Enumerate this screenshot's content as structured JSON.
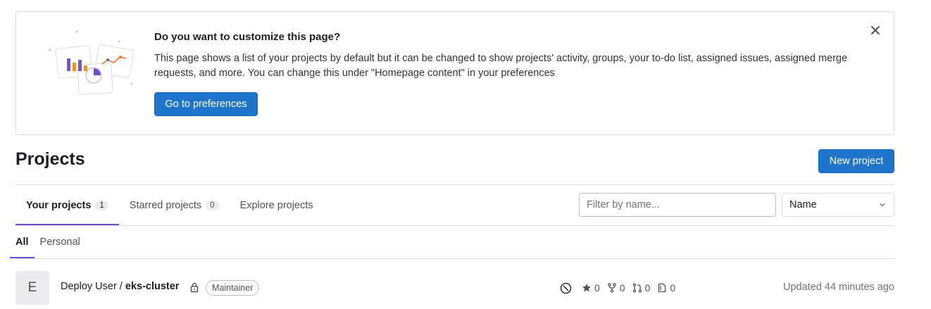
{
  "banner": {
    "title": "Do you want to customize this page?",
    "body": "This page shows a list of your projects by default but it can be changed to show projects' activity, groups, your to-do list, assigned issues, assigned merge requests, and more. You can change this under \"Homepage content\" in your preferences",
    "button_label": "Go to preferences",
    "close_icon": "close-icon"
  },
  "header": {
    "title": "Projects",
    "new_project_label": "New project"
  },
  "tabs": [
    {
      "label": "Your projects",
      "count": "1",
      "active": true
    },
    {
      "label": "Starred projects",
      "count": "0",
      "active": false
    },
    {
      "label": "Explore projects",
      "count": "",
      "active": false
    }
  ],
  "filter": {
    "placeholder": "Filter by name...",
    "sort_value": "Name"
  },
  "subtabs": [
    {
      "label": "All",
      "active": true
    },
    {
      "label": "Personal",
      "active": false
    }
  ],
  "project": {
    "avatar_letter": "E",
    "namespace": "Deploy User / ",
    "name": "eks-cluster",
    "visibility_icon": "lock-icon",
    "role": "Maintainer",
    "stats": {
      "stars": "0",
      "forks": "0",
      "merge_requests": "0",
      "issues": "0"
    },
    "updated": "Updated 44 minutes ago"
  },
  "colors": {
    "primary": "#1f75cb",
    "active_tab_underline": "#6e49cb"
  }
}
